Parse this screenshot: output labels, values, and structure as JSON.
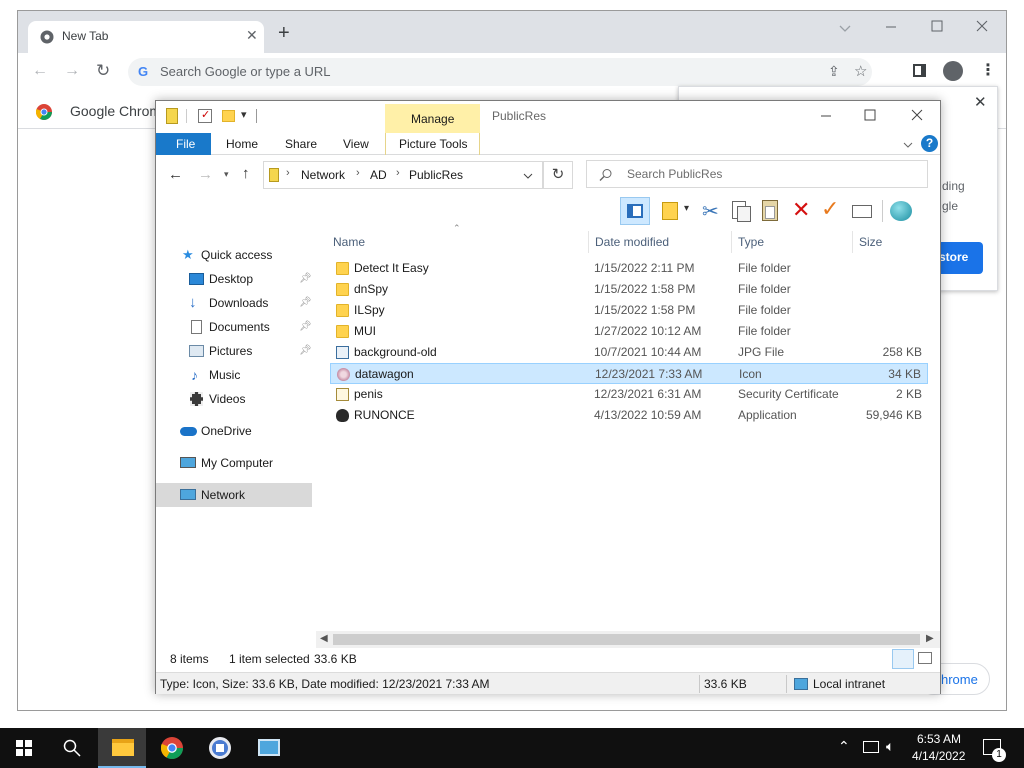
{
  "chrome": {
    "tab_title": "New Tab",
    "omnibox_placeholder": "Search Google or type a URL",
    "bookmark_item": "Google Chrome",
    "promo_partial_1": "ding",
    "promo_partial_2": "gle",
    "promo_button": "store",
    "customize_partial": "hrome"
  },
  "explorer": {
    "title": "PublicRes",
    "ribbon_context_tab": "Manage",
    "ribbon_context_group": "Picture Tools",
    "ribbon_tabs": [
      "File",
      "Home",
      "Share",
      "View"
    ],
    "breadcrumb": [
      "Network",
      "AD",
      "PublicRes"
    ],
    "search_placeholder": "Search PublicRes",
    "nav": {
      "quick_access": "Quick access",
      "items": [
        "Desktop",
        "Downloads",
        "Documents",
        "Pictures",
        "Music",
        "Videos"
      ],
      "onedrive": "OneDrive",
      "my_computer": "My Computer",
      "network": "Network"
    },
    "columns": {
      "name": "Name",
      "date": "Date modified",
      "type": "Type",
      "size": "Size"
    },
    "files": [
      {
        "name": "Detect It Easy",
        "date": "1/15/2022 2:11 PM",
        "type": "File folder",
        "size": "",
        "icon": "folder-icon"
      },
      {
        "name": "dnSpy",
        "date": "1/15/2022 1:58 PM",
        "type": "File folder",
        "size": "",
        "icon": "folder-icon"
      },
      {
        "name": "ILSpy",
        "date": "1/15/2022 1:58 PM",
        "type": "File folder",
        "size": "",
        "icon": "folder-icon"
      },
      {
        "name": "MUI",
        "date": "1/27/2022 10:12 AM",
        "type": "File folder",
        "size": "",
        "icon": "folder-icon"
      },
      {
        "name": "background-old",
        "date": "10/7/2021 10:44 AM",
        "type": "JPG File",
        "size": "258 KB",
        "icon": "image-file-icon"
      },
      {
        "name": "datawagon",
        "date": "12/23/2021 7:33 AM",
        "type": "Icon",
        "size": "34 KB",
        "icon": "icon-file-icon",
        "selected": true
      },
      {
        "name": "penis",
        "date": "12/23/2021 6:31 AM",
        "type": "Security Certificate",
        "size": "2 KB",
        "icon": "certificate-icon"
      },
      {
        "name": "RUNONCE",
        "date": "4/13/2022 10:59 AM",
        "type": "Application",
        "size": "59,946 KB",
        "icon": "application-icon"
      }
    ],
    "status": {
      "items": "8 items",
      "selected": "1 item selected",
      "selected_size": "33.6 KB"
    },
    "details_bar": {
      "text": "Type: Icon, Size: 33.6 KB, Date modified: 12/23/2021 7:33 AM",
      "size": "33.6 KB",
      "zone": "Local intranet"
    }
  },
  "taskbar": {
    "time": "6:53 AM",
    "date": "4/14/2022",
    "notification_count": "1"
  }
}
